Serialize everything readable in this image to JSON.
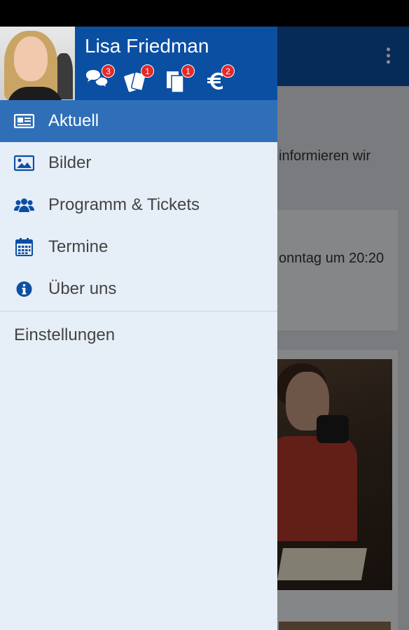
{
  "user": {
    "name": "Lisa Friedman"
  },
  "header_icons": [
    {
      "icon": "chat-bubbles-icon",
      "badge": "3"
    },
    {
      "icon": "tickets-icon",
      "badge": "1"
    },
    {
      "icon": "documents-icon",
      "badge": "1"
    },
    {
      "icon": "euro-icon",
      "badge": "2"
    }
  ],
  "menu": {
    "items": [
      {
        "label": "Aktuell",
        "icon": "newspaper-icon",
        "active": true
      },
      {
        "label": "Bilder",
        "icon": "image-icon",
        "active": false
      },
      {
        "label": "Programm & Tickets",
        "icon": "users-icon",
        "active": false
      },
      {
        "label": "Termine",
        "icon": "calendar-icon",
        "active": false
      },
      {
        "label": "Über uns",
        "icon": "info-icon",
        "active": false
      }
    ],
    "settings_label": "Einstellungen"
  },
  "background": {
    "text_line_1": "informieren wir",
    "text_line_2": "onntag um 20:20"
  },
  "colors": {
    "primary": "#0b4fa3",
    "active_item": "#2f6fb8",
    "drawer_bg": "#e6eef7",
    "badge": "#e32a2a"
  }
}
